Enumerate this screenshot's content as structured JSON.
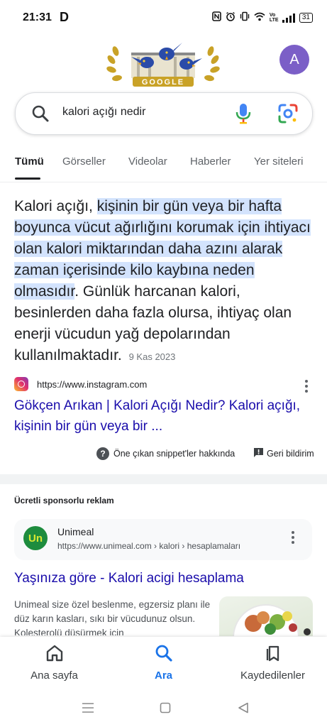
{
  "status_bar": {
    "time": "21:31",
    "app_letter": "D",
    "network_label": "Vo LTE",
    "battery": "31"
  },
  "header": {
    "logo_text": "GOOGLE",
    "avatar_letter": "A"
  },
  "search": {
    "query": "kalori açığı nedir"
  },
  "tabs": [
    "Tümü",
    "Görseller",
    "Videolar",
    "Haberler",
    "Yer siteleri"
  ],
  "snippet": {
    "prefix": "Kalori açığı, ",
    "highlighted": "kişinin bir gün veya bir hafta boyunca vücut ağırlığını korumak için ihtiyacı olan kalori miktarından daha azını alarak zaman içerisinde kilo kaybına neden olmasıdır",
    "suffix": ". Günlük harcanan kalori, besinlerden daha fazla olursa, ihtiyaç olan enerji vücudun yağ depolarından kullanılmaktadır.",
    "date": "9 Kas 2023"
  },
  "result": {
    "url": "https://www.instagram.com",
    "title": "Gökçen Arıkan | Kalori Açığı Nedir? Kalori açığı, kişinin bir gün veya bir ..."
  },
  "snippet_footer": {
    "about": "Öne çıkan snippet'ler hakkında",
    "feedback": "Geri bildirim"
  },
  "ad": {
    "label": "Ücretli sponsorlu reklam",
    "logo_text": "Un",
    "name": "Unimeal",
    "url": "https://www.unimeal.com › kalori › hesaplamaları",
    "title": "Yaşınıza göre - Kalori acigi hesaplama",
    "description": "Unimeal size özel beslenme, egzersiz planı ile düz karın kasları, sıkı bir vücudunuz olsun. Kolesterolü düşürmek için"
  },
  "bottom_nav": {
    "home": "Ana sayfa",
    "search": "Ara",
    "saved": "Kaydedilenler"
  },
  "colors": {
    "accent": "#1a73e8",
    "link": "#1a0dab",
    "highlight": "#d3e3fd",
    "avatar": "#7b5fc7"
  }
}
